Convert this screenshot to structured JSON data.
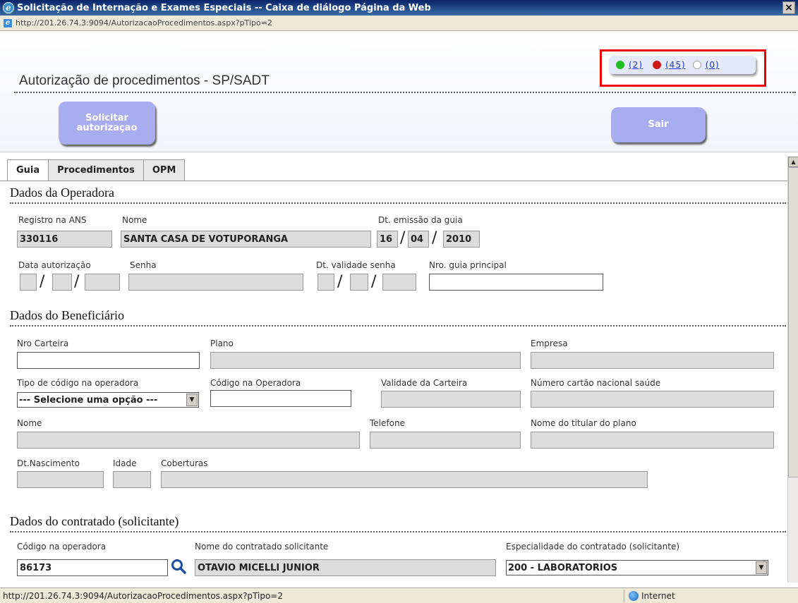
{
  "window": {
    "title": "Solicitação de Internação e Exames Especiais -- Caixa de diálogo Página da Web",
    "close": "×",
    "address": "http://201.26.74.3:9094/AutorizacaoProcedimentos.aspx?pTipo=2"
  },
  "header": {
    "title": "Autorização de procedimentos - SP/SADT",
    "alerts": [
      {
        "label": "(2)",
        "color": "#22c022"
      },
      {
        "label": "(45)",
        "color": "#d01818"
      },
      {
        "label": "(0)",
        "color": "#bbbbbb"
      }
    ],
    "solicitar_label": "Solicitar autorizaçao",
    "sair_label": "Sair"
  },
  "tabs": [
    {
      "label": "Guia",
      "active": true
    },
    {
      "label": "Procedimentos",
      "active": false
    },
    {
      "label": "OPM",
      "active": false
    }
  ],
  "operadora": {
    "section": "Dados da Operadora",
    "registro_label": "Registro na ANS",
    "registro_value": "330116",
    "nome_label": "Nome",
    "nome_value": "SANTA CASA DE VOTUPORANGA",
    "emissao_label": "Dt. emissão da guia",
    "emissao_dia": "16",
    "emissao_mes": "04",
    "emissao_ano": "2010",
    "data_aut_label": "Data autorização",
    "senha_label": "Senha",
    "validade_senha_label": "Dt. validade senha",
    "guia_principal_label": "Nro. guia principal"
  },
  "beneficiario": {
    "section": "Dados do Beneficiário",
    "carteira_label": "Nro Carteira",
    "plano_label": "Plano",
    "empresa_label": "Empresa",
    "tipo_codigo_label": "Tipo de código na operadora",
    "tipo_codigo_value": "--- Selecione uma opção ---",
    "codigo_operadora_label": "Código na Operadora",
    "validade_carteira_label": "Validade da Carteira",
    "cartao_nacional_label": "Número cartão nacional saúde",
    "nome_label": "Nome",
    "telefone_label": "Telefone",
    "titular_label": "Nome do titular do plano",
    "nascimento_label": "Dt.Nascimento",
    "idade_label": "Idade",
    "coberturas_label": "Coberturas"
  },
  "contratado": {
    "section": "Dados do contratado (solicitante)",
    "codigo_label": "Código na operadora",
    "codigo_value": "86173",
    "nome_label": "Nome do contratado solicitante",
    "nome_value": "OTAVIO MICELLI JUNIOR",
    "especialidade_label": "Especialidade do contratado (solicitante)",
    "especialidade_value": "200 - LABORATORIOS"
  },
  "status": {
    "url": "http://201.26.74.3:9094/AutorizacaoProcedimentos.aspx?pTipo=2",
    "zone": "Internet"
  },
  "colors": {
    "button": "#a8adf0",
    "alert_border": "#ee0000",
    "link": "#1a37c4"
  }
}
